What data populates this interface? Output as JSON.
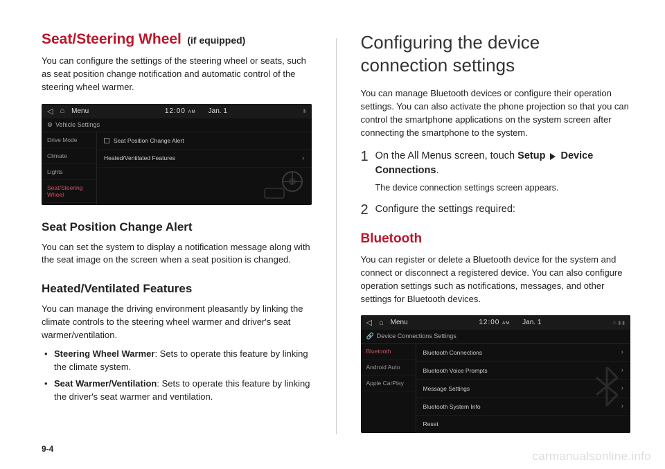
{
  "page_number": "9-4",
  "watermark": "carmanualsonline.info",
  "left": {
    "title": "Seat/Steering Wheel",
    "title_suffix": "(if equipped)",
    "intro": "You can configure the settings of the steering wheel or seats, such as seat position change notification and automatic control of the steering wheel warmer.",
    "shot": {
      "menu_label": "Menu",
      "clock": "12:00",
      "ampm": "AM",
      "date": "Jan. 1",
      "subtitle": "Vehicle Settings",
      "side": {
        "item0": "Drive Mode",
        "item1": "Climate",
        "item2": "Lights",
        "item3": "Seat/Steering Wheel"
      },
      "main": {
        "item0": "Seat Position Change Alert",
        "item1": "Heated/Ventilated Features"
      }
    },
    "sec1_title": "Seat Position Change Alert",
    "sec1_body": "You can set the system to display a notification message along with the seat image on the screen when a seat position is changed.",
    "sec2_title": "Heated/Ventilated Features",
    "sec2_body": "You can manage the driving environment pleasantly by linking the climate controls to the steering wheel warmer and driver's seat warmer/ventilation.",
    "bullet1_bold": "Steering Wheel Warmer",
    "bullet1_rest": ": Sets to operate this feature by linking the climate system.",
    "bullet2_bold": "Seat Warmer/Ventilation",
    "bullet2_rest": ": Sets to operate this feature by linking the driver's seat warmer and ventilation."
  },
  "right": {
    "title": "Configuring the device connection settings",
    "intro": "You can manage Bluetooth devices or configure their operation settings. You can also activate the phone projection so that you can control the smartphone applications on the system screen after connecting the smartphone to the system.",
    "step1_num": "1",
    "step1_pre": "On the All Menus screen, touch ",
    "step1_b1": "Setup",
    "step1_b2": "Device Connections",
    "step1_post": ".",
    "step1_sub": "The device connection settings screen appears.",
    "step2_num": "2",
    "step2_body": "Configure the settings required:",
    "bt_title": "Bluetooth",
    "bt_body": "You can register or delete a Bluetooth device for the system and connect or disconnect a registered device. You can also configure operation settings such as notifications, messages, and other settings for Bluetooth devices.",
    "shot": {
      "menu_label": "Menu",
      "clock": "12:00",
      "ampm": "AM",
      "date": "Jan. 1",
      "subtitle": "Device Connections Settings",
      "side": {
        "item0": "Bluetooth",
        "item1": "Android Auto",
        "item2": "Apple CarPlay"
      },
      "main": {
        "item0": "Bluetooth Connections",
        "item1": "Bluetooth Voice Prompts",
        "item2": "Message Settings",
        "item3": "Bluetooth System Info",
        "item4": "Reset"
      }
    }
  }
}
